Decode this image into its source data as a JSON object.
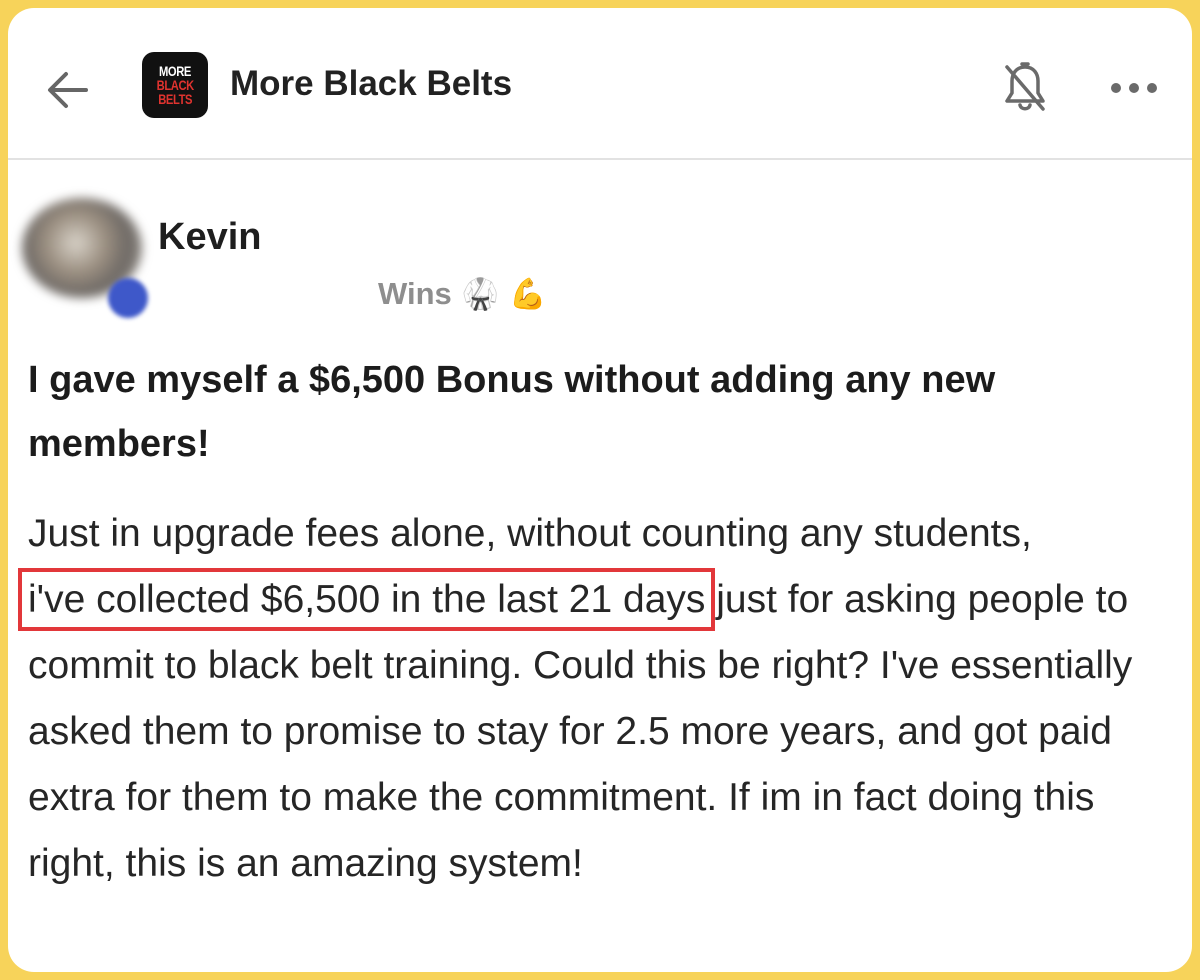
{
  "header": {
    "group_name": "More Black Belts",
    "logo": {
      "line1": "MORE",
      "line2": "BLACK",
      "line3": "BELTS"
    }
  },
  "icons": {
    "back": "arrow-left-icon",
    "notifications": "bell-off-icon",
    "more": "more-horizontal-icon"
  },
  "post": {
    "author": "Kevin",
    "category": "Wins",
    "category_emojis": [
      "🥋",
      "💪"
    ],
    "title": "I gave myself a $6,500 Bonus without adding any new members!",
    "body_before": "Just in upgrade fees alone, without counting any students,",
    "body_highlight": "i've collected $6,500 in the last 21 days",
    "body_after": " just for asking people to commit to black belt training. Could this be right? I've essentially asked them to promise to stay for 2.5 more years, and got paid extra for them to make the commitment. If im in fact doing this right, this is an amazing system!"
  },
  "colors": {
    "frame": "#f7d35a",
    "highlight_box": "#e2373a",
    "logo_red": "#e0332f",
    "avatar_badge": "#3e58c9"
  }
}
